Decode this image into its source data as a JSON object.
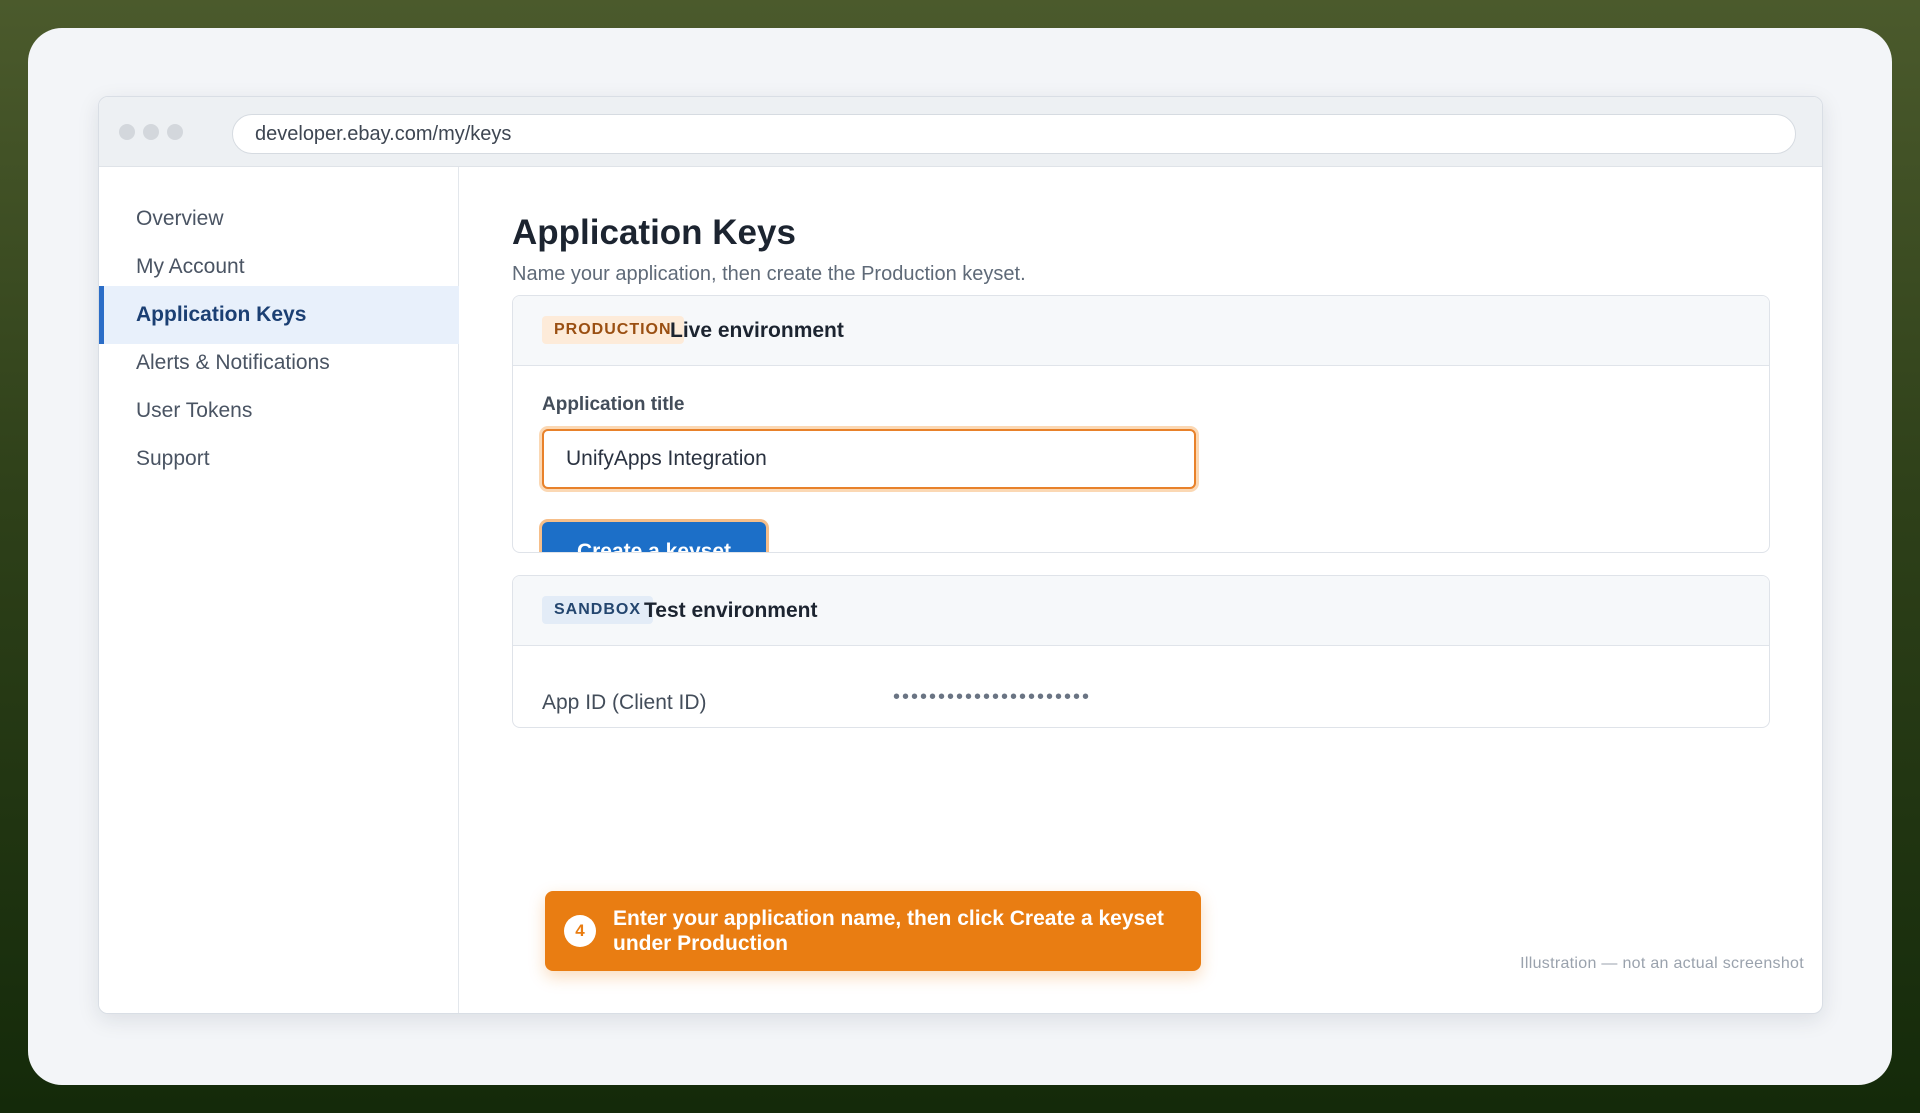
{
  "browser": {
    "url": "developer.ebay.com/my/keys"
  },
  "sidebar": {
    "items": [
      {
        "label": "Overview"
      },
      {
        "label": "My Account"
      },
      {
        "label": "Application Keys"
      },
      {
        "label": "Alerts & Notifications"
      },
      {
        "label": "User Tokens"
      },
      {
        "label": "Support"
      }
    ],
    "active_index": 2
  },
  "main": {
    "title": "Application Keys",
    "subtitle": "Name your application, then create the Production keyset.",
    "production": {
      "badge": "PRODUCTION",
      "environment": "Live environment",
      "field_label": "Application title",
      "field_value": "UnifyApps Integration",
      "button_label": "Create a keyset"
    },
    "sandbox": {
      "badge": "SANDBOX",
      "environment": "Test environment",
      "row_label": "App ID (Client ID)",
      "row_value": "••••••••••••••••••••••"
    }
  },
  "callout": {
    "step": "4",
    "text": "Enter your application name, then click Create a keyset under Production"
  },
  "footer": {
    "note": "Illustration — not an actual screenshot"
  },
  "colors": {
    "accent": "#1c6fc8",
    "highlight": "#e97d12",
    "active_nav_bg": "#e8f0fb"
  }
}
